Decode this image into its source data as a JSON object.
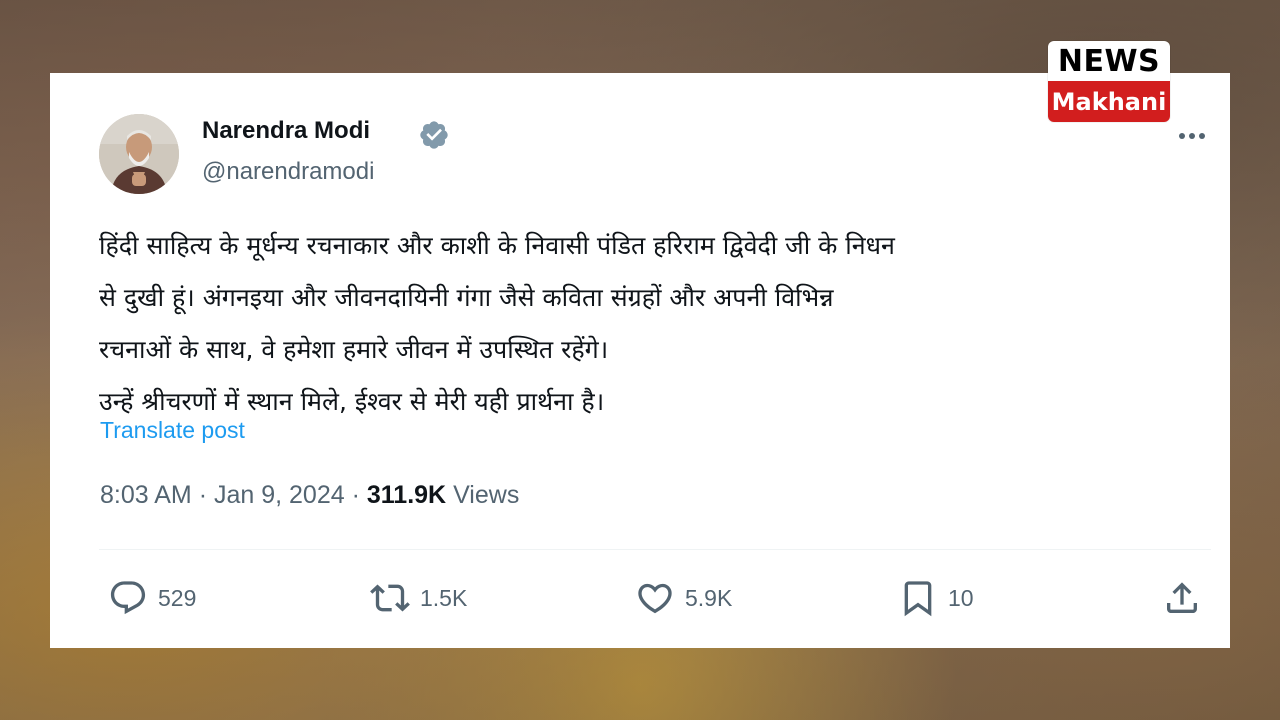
{
  "post": {
    "author_name": "Narendra Modi",
    "author_handle": "@narendramodi",
    "verified": true,
    "verified_color": "#829aab",
    "text_lines": [
      "हिंदी साहित्य के मूर्धन्य रचनाकार और काशी के निवासी पंडित हरिराम द्विवेदी जी के निधन",
      "से दुखी हूं। अंगनइया और जीवनदायिनी गंगा जैसे कविता संग्रहों और अपनी विभिन्न",
      "रचनाओं के साथ, वे हमेशा हमारे जीवन में उपस्थित रहेंगे।",
      "उन्हें श्रीचरणों में स्थान मिले, ईश्वर से मेरी यही प्रार्थना है।"
    ],
    "translate_label": "Translate post",
    "time": "8:03 AM",
    "date": "Jan 9, 2024",
    "separator": "·",
    "views_count": "311.9K",
    "views_label": "Views"
  },
  "actions": {
    "replies": "529",
    "reposts": "1.5K",
    "likes": "5.9K",
    "bookmarks": "10"
  },
  "icons": {
    "reply": "speech-bubble-icon",
    "repost": "repost-arrows-icon",
    "like": "heart-icon",
    "bookmark": "bookmark-icon",
    "share": "share-upload-icon",
    "more": "more-dots-icon",
    "verified": "verified-badge-icon"
  },
  "watermark": {
    "top": "NEWS",
    "bottom": "Makhani",
    "bottom_color": "#d21e1e"
  },
  "colors": {
    "text_primary": "#0f1419",
    "text_secondary": "#536471",
    "link": "#1d9bf0"
  }
}
